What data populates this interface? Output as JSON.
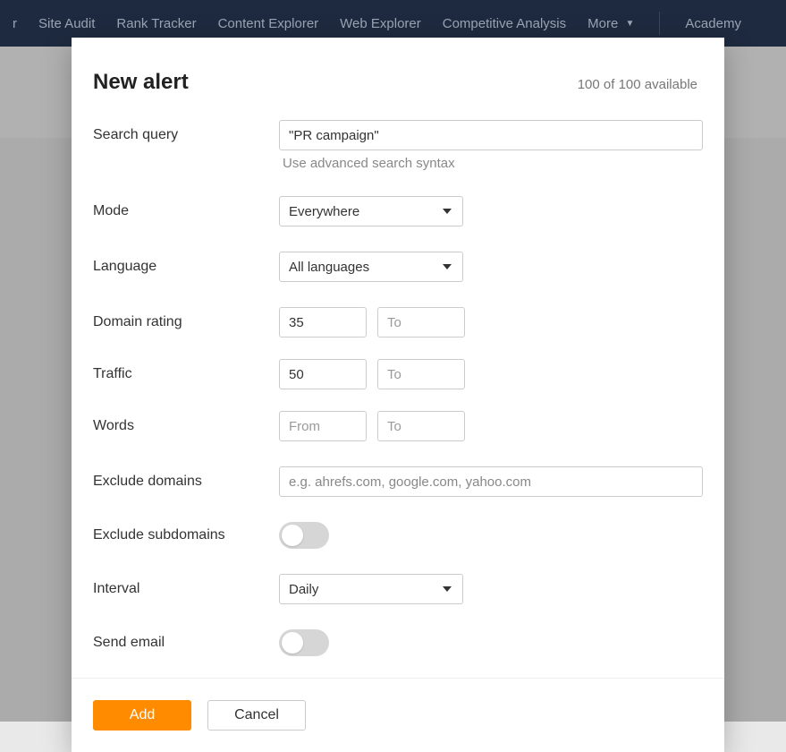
{
  "nav": {
    "items": [
      {
        "label": "r"
      },
      {
        "label": "Site Audit"
      },
      {
        "label": "Rank Tracker"
      },
      {
        "label": "Content Explorer"
      },
      {
        "label": "Web Explorer"
      },
      {
        "label": "Competitive Analysis"
      },
      {
        "label": "More"
      }
    ],
    "right": [
      {
        "label": "Academy"
      }
    ]
  },
  "modal": {
    "title": "New alert",
    "available": "100 of 100 available",
    "labels": {
      "search_query": "Search query",
      "mode": "Mode",
      "language": "Language",
      "domain_rating": "Domain rating",
      "traffic": "Traffic",
      "words": "Words",
      "exclude_domains": "Exclude domains",
      "exclude_subdomains": "Exclude subdomains",
      "interval": "Interval",
      "send_email": "Send email"
    },
    "values": {
      "search_query": "\"PR campaign\"",
      "mode": "Everywhere",
      "language": "All languages",
      "domain_rating_from": "35",
      "domain_rating_to": "",
      "traffic_from": "50",
      "traffic_to": "",
      "words_from": "",
      "words_to": "",
      "exclude_domains": "",
      "interval": "Daily"
    },
    "placeholders": {
      "from": "From",
      "to": "To",
      "exclude_domains": "e.g. ahrefs.com, google.com, yahoo.com"
    },
    "hint": "Use advanced search syntax",
    "buttons": {
      "add": "Add",
      "cancel": "Cancel"
    }
  }
}
